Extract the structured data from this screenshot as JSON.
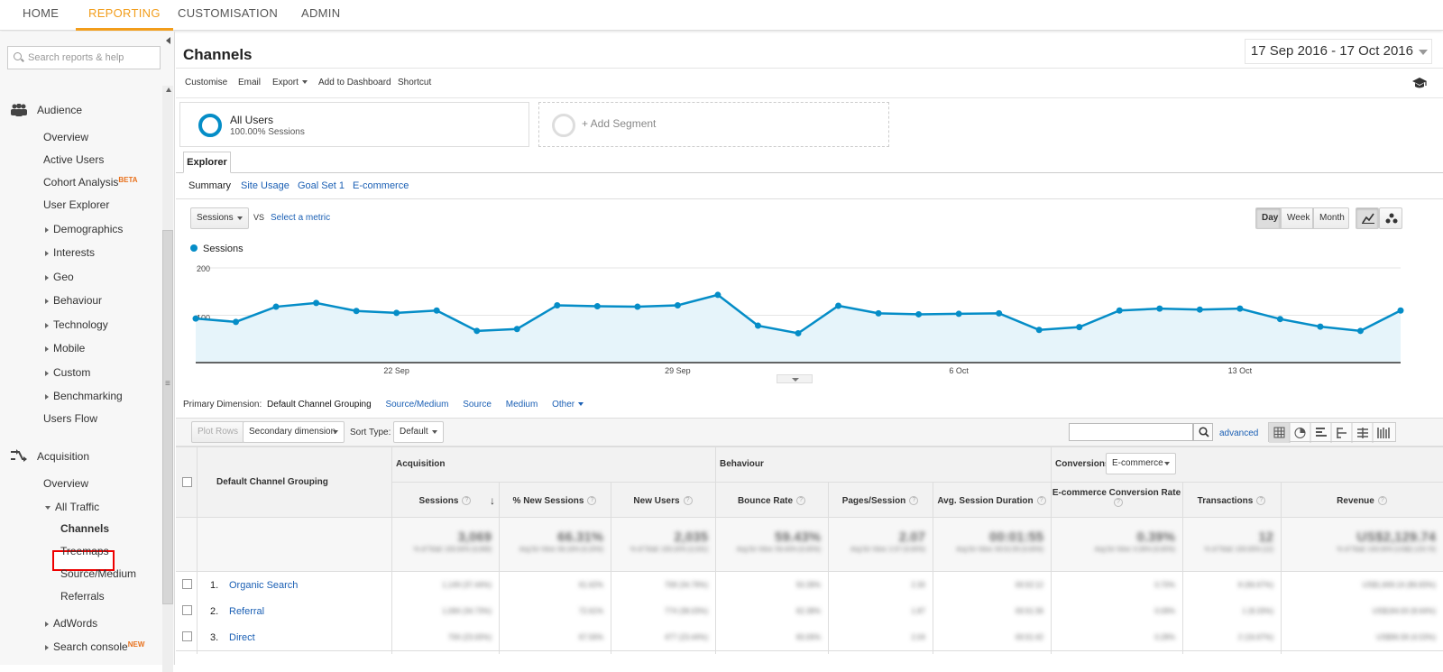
{
  "topnav": {
    "tabs": [
      {
        "label": "HOME"
      },
      {
        "label": "REPORTING"
      },
      {
        "label": "CUSTOMISATION"
      },
      {
        "label": "ADMIN"
      }
    ]
  },
  "sidebar": {
    "search_placeholder": "Search reports & help",
    "audience_label": "Audience",
    "audience_items": [
      "Overview",
      "Active Users",
      "Cohort Analysis",
      "User Explorer",
      "Demographics",
      "Interests",
      "Geo",
      "Behaviour",
      "Technology",
      "Mobile",
      "Custom",
      "Benchmarking",
      "Users Flow"
    ],
    "beta_badge": "BETA",
    "acquisition_label": "Acquisition",
    "acquisition_items": [
      "Overview",
      "All Traffic",
      "Channels",
      "Treemaps",
      "Source/Medium",
      "Referrals",
      "AdWords",
      "Search console"
    ],
    "new_badge": "NEW"
  },
  "header": {
    "title": "Channels",
    "date_range": "17 Sep 2016 - 17 Oct 2016"
  },
  "toolbar": {
    "customise": "Customise",
    "email": "Email",
    "export": "Export",
    "add_to_dashboard": "Add to Dashboard",
    "shortcut": "Shortcut"
  },
  "segments": {
    "all_users": "All Users",
    "all_users_sub": "100.00% Sessions",
    "add_segment": "+ Add Segment"
  },
  "explorer": {
    "tab": "Explorer",
    "subtabs": [
      "Summary",
      "Site Usage",
      "Goal Set 1",
      "E-commerce"
    ],
    "metric": "Sessions",
    "vs": "VS",
    "select_metric": "Select a metric",
    "granularity": [
      "Day",
      "Week",
      "Month"
    ]
  },
  "chart_data": {
    "type": "area",
    "series": [
      {
        "name": "Sessions",
        "values": [
          93,
          86,
          118,
          126,
          109,
          105,
          110,
          67,
          71,
          121,
          119,
          118,
          121,
          143,
          78,
          62,
          120,
          104,
          102,
          103,
          104,
          69,
          75,
          110,
          114,
          112,
          114,
          92,
          76,
          67,
          110
        ]
      }
    ],
    "x_start": "17 Sep",
    "tick_labels": [
      "22 Sep",
      "29 Sep",
      "6 Oct",
      "13 Oct"
    ],
    "ytick_labels": [
      "200",
      "100"
    ],
    "ylim": [
      0,
      200
    ],
    "grid": true,
    "legend": "top-left",
    "color": "#058dc7"
  },
  "primary_dimension": {
    "label": "Primary Dimension:",
    "current": "Default Channel Grouping",
    "options": [
      "Source/Medium",
      "Source",
      "Medium",
      "Other"
    ]
  },
  "table_toolbar": {
    "plot_rows": "Plot Rows",
    "secondary_dimension": "Secondary dimension",
    "sort_type_label": "Sort Type:",
    "sort_type": "Default",
    "advanced": "advanced"
  },
  "table": {
    "dimension_header": "Default Channel Grouping",
    "groups": [
      "Acquisition",
      "Behaviour",
      "Conversions"
    ],
    "conversions_select": "E-commerce",
    "columns": [
      "Sessions",
      "% New Sessions",
      "New Users",
      "Bounce Rate",
      "Pages/Session",
      "Avg. Session Duration",
      "E-commerce Conversion Rate",
      "Transactions",
      "Revenue"
    ],
    "totals": [
      "3,069",
      "66.31%",
      "2,035",
      "59.43%",
      "2.07",
      "00:01:55",
      "0.39%",
      "12",
      "US$2,129.74"
    ],
    "totals_sub": [
      "% of Total: 100.00% (3,069)",
      "Avg for View: 66.18% (0.20%)",
      "% of Total: 100.20% (2,031)",
      "Avg for View: 59.43% (0.00%)",
      "Avg for View: 2.07 (0.00%)",
      "Avg for View: 00:01:55 (0.00%)",
      "Avg for View: 0.39% (0.00%)",
      "% of Total: 100.00% (12)",
      "% of Total: 100.00% (US$2,129.74)"
    ],
    "rows": [
      {
        "num": "1.",
        "name": "Organic Search",
        "values": [
          "1,149 (37.44%)",
          "61.62%",
          "708 (34.79%)",
          "50.39%",
          "2.30",
          "00:02:12",
          "0.70%",
          "8 (66.67%)",
          "US$1,849.16 (86.83%)"
        ]
      },
      {
        "num": "2.",
        "name": "Referral",
        "values": [
          "1,066 (34.73%)",
          "72.61%",
          "774 (38.03%)",
          "62.38%",
          "1.87",
          "00:01:36",
          "0.09%",
          "1 (8.33%)",
          "US$184.00 (8.64%)"
        ]
      },
      {
        "num": "3.",
        "name": "Direct",
        "values": [
          "706 (23.00%)",
          "67.56%",
          "477 (23.44%)",
          "60.06%",
          "2.04",
          "00:01:42",
          "0.28%",
          "2 (16.67%)",
          "US$96.58 (4.53%)"
        ]
      }
    ]
  }
}
